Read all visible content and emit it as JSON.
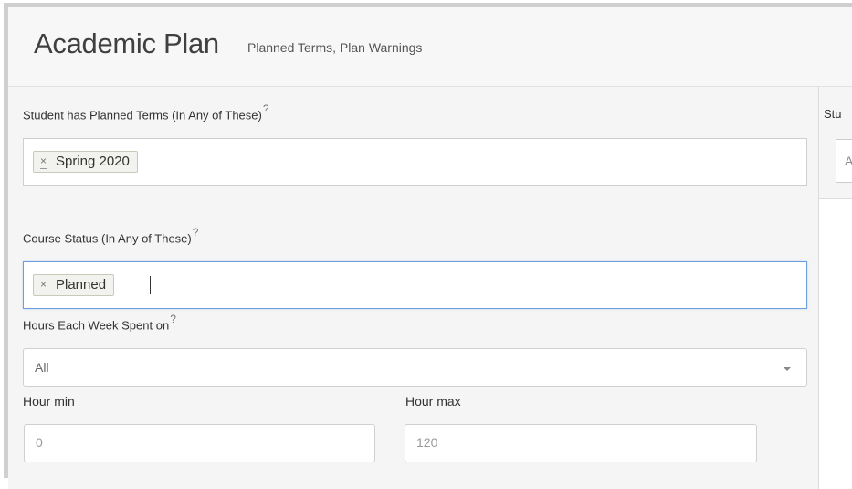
{
  "header": {
    "title": "Academic Plan",
    "subtitle": "Planned Terms, Plan Warnings"
  },
  "filters": {
    "planned_terms": {
      "label": "Student has Planned Terms (In Any of These)",
      "help": "?",
      "tags": [
        "Spring 2020"
      ],
      "remove_glyph": "×"
    },
    "course_status": {
      "label": "Course Status (In Any of These)",
      "help": "?",
      "tags": [
        "Planned"
      ],
      "remove_glyph": "×"
    },
    "hours_each_week": {
      "label": "Hours Each Week Spent on",
      "help": "?",
      "selected": "All"
    },
    "hour_min": {
      "label": "Hour min",
      "placeholder": "0"
    },
    "hour_max": {
      "label": "Hour max",
      "placeholder": "120"
    }
  },
  "right_panel": {
    "label_partial": "Stu",
    "input_partial": "A"
  },
  "colors": {
    "focus_border": "#6aa0e0",
    "panel_bg": "#f5f5f5",
    "tag_bg": "#f2f2ef"
  }
}
